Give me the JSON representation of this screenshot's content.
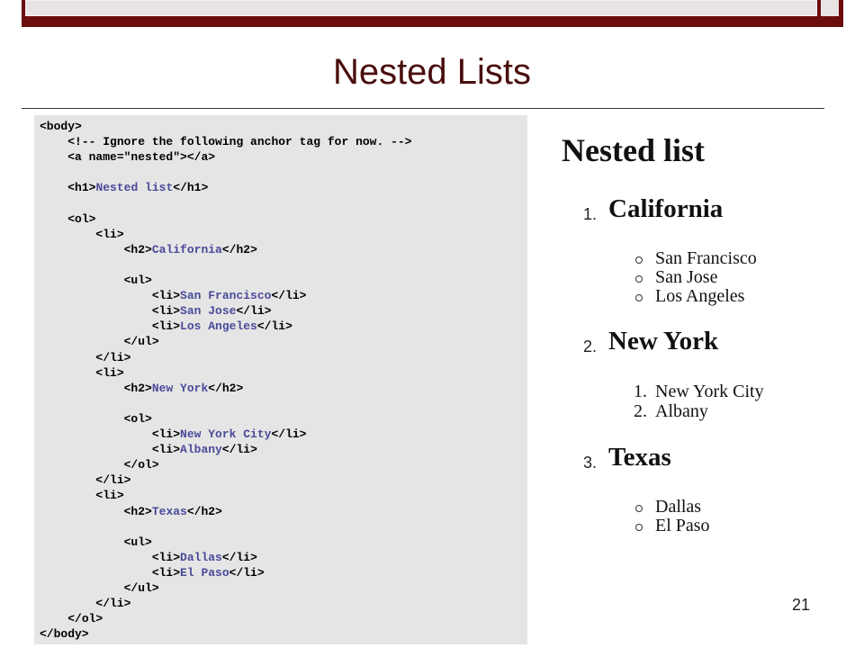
{
  "slide": {
    "title": "Nested Lists",
    "page_number": "21"
  },
  "code_lines": [
    "<body>",
    "    <!-- Ignore the following anchor tag for now. -->",
    "    <a name=\"nested\"></a>",
    "",
    "    <h1>Nested list</h1>",
    "",
    "    <ol>",
    "        <li>",
    "            <h2>California</h2>",
    "",
    "            <ul>",
    "                <li>San Francisco</li>",
    "                <li>San Jose</li>",
    "                <li>Los Angeles</li>",
    "            </ul>",
    "        </li>",
    "        <li>",
    "            <h2>New York</h2>",
    "",
    "            <ol>",
    "                <li>New York City</li>",
    "                <li>Albany</li>",
    "            </ol>",
    "        </li>",
    "        <li>",
    "            <h2>Texas</h2>",
    "",
    "            <ul>",
    "                <li>Dallas</li>",
    "                <li>El Paso</li>",
    "            </ul>",
    "        </li>",
    "    </ol>",
    "</body>"
  ],
  "rendered": {
    "heading": "Nested list",
    "items": [
      {
        "num": "1.",
        "name": "California",
        "list_type": "ul",
        "sub": [
          "San Francisco",
          "San Jose",
          "Los Angeles"
        ]
      },
      {
        "num": "2.",
        "name": "New York",
        "list_type": "ol",
        "sub": [
          "New York City",
          "Albany"
        ],
        "sub_nums": [
          "1.",
          "2."
        ]
      },
      {
        "num": "3.",
        "name": "Texas",
        "list_type": "ul",
        "sub": [
          "Dallas",
          "El Paso"
        ]
      }
    ]
  }
}
